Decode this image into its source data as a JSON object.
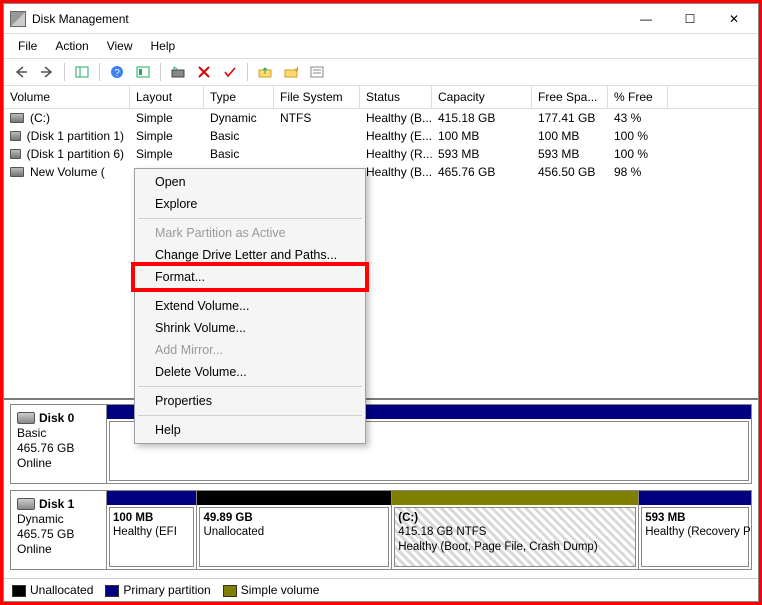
{
  "window": {
    "title": "Disk Management",
    "buttons": {
      "min": "—",
      "max": "☐",
      "close": "✕"
    }
  },
  "menubar": [
    "File",
    "Action",
    "View",
    "Help"
  ],
  "columns": [
    "Volume",
    "Layout",
    "Type",
    "File System",
    "Status",
    "Capacity",
    "Free Spa...",
    "% Free"
  ],
  "volumes": [
    {
      "name": "(C:)",
      "layout": "Simple",
      "type": "Dynamic",
      "fs": "NTFS",
      "status": "Healthy (B...",
      "capacity": "415.18 GB",
      "free": "177.41 GB",
      "pct": "43 %"
    },
    {
      "name": "(Disk 1 partition 1)",
      "layout": "Simple",
      "type": "Basic",
      "fs": "",
      "status": "Healthy (E...",
      "capacity": "100 MB",
      "free": "100 MB",
      "pct": "100 %"
    },
    {
      "name": "(Disk 1 partition 6)",
      "layout": "Simple",
      "type": "Basic",
      "fs": "",
      "status": "Healthy (R...",
      "capacity": "593 MB",
      "free": "593 MB",
      "pct": "100 %"
    },
    {
      "name": "New Volume (",
      "layout": "",
      "type": "",
      "fs": "",
      "status": "Healthy (B...",
      "capacity": "465.76 GB",
      "free": "456.50 GB",
      "pct": "98 %"
    }
  ],
  "context_menu": {
    "items": [
      {
        "label": "Open",
        "enabled": true
      },
      {
        "label": "Explore",
        "enabled": true
      },
      {
        "sep": true
      },
      {
        "label": "Mark Partition as Active",
        "enabled": false
      },
      {
        "label": "Change Drive Letter and Paths...",
        "enabled": true
      },
      {
        "label": "Format...",
        "enabled": true,
        "highlight": true
      },
      {
        "sep": true
      },
      {
        "label": "Extend Volume...",
        "enabled": true
      },
      {
        "label": "Shrink Volume...",
        "enabled": true
      },
      {
        "label": "Add Mirror...",
        "enabled": false
      },
      {
        "label": "Delete Volume...",
        "enabled": true
      },
      {
        "sep": true
      },
      {
        "label": "Properties",
        "enabled": true
      },
      {
        "sep": true
      },
      {
        "label": "Help",
        "enabled": true
      }
    ]
  },
  "disks": [
    {
      "label": "Disk 0",
      "type": "Basic",
      "size": "465.76 GB",
      "status": "Online",
      "parts": [
        {
          "bar": "navy",
          "grow": 1,
          "lines": []
        }
      ]
    },
    {
      "label": "Disk 1",
      "type": "Dynamic",
      "size": "465.75 GB",
      "status": "Online",
      "parts": [
        {
          "bar": "navy",
          "grow": 12,
          "lines": [
            "100 MB",
            "Healthy (EFI"
          ]
        },
        {
          "bar": "black",
          "grow": 26,
          "lines": [
            "49.89 GB",
            "Unallocated"
          ]
        },
        {
          "bar": "olive",
          "grow": 33,
          "hatch": true,
          "lines": [
            "(C:)",
            "415.18 GB NTFS",
            "Healthy (Boot, Page File, Crash Dump)"
          ]
        },
        {
          "bar": "navy",
          "grow": 15,
          "lines": [
            "593 MB",
            "Healthy (Recovery P"
          ]
        }
      ]
    }
  ],
  "legend": {
    "unallocated": "Unallocated",
    "primary": "Primary partition",
    "simple": "Simple volume"
  }
}
